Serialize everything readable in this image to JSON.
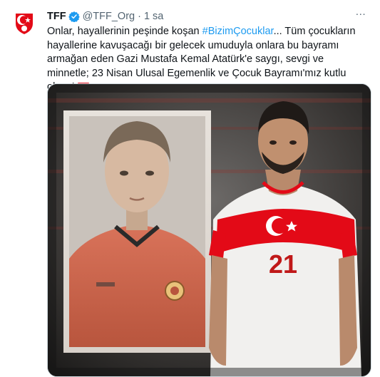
{
  "tweet": {
    "display_name": "TFF",
    "handle": "@TFF_Org",
    "separator": "·",
    "time": "1 sa",
    "more": "···",
    "text_part1": "Onlar, hayallerinin peşinde koşan ",
    "hashtag": "#BizimÇocuklar",
    "text_part2": "... Tüm çocukların hayallerine kavuşacağı bir gelecek umuduyla onlara bu bayramı armağan eden Gazi Mustafa Kemal Atatürk'e saygı, sevgi ve minnetle; 23 Nisan Ulusal Egemenlik ve Çocuk Bayramı'mız kutlu olsun!",
    "jersey_number": "21"
  },
  "colors": {
    "link": "#1d9bf0",
    "verified": "#1d9bf0",
    "turkey_red": "#e30a17",
    "secondary_text": "#536471"
  },
  "icons": {
    "verified": "verified-badge-icon",
    "flag": "turkey-flag-emoji",
    "more": "more-options-icon"
  }
}
